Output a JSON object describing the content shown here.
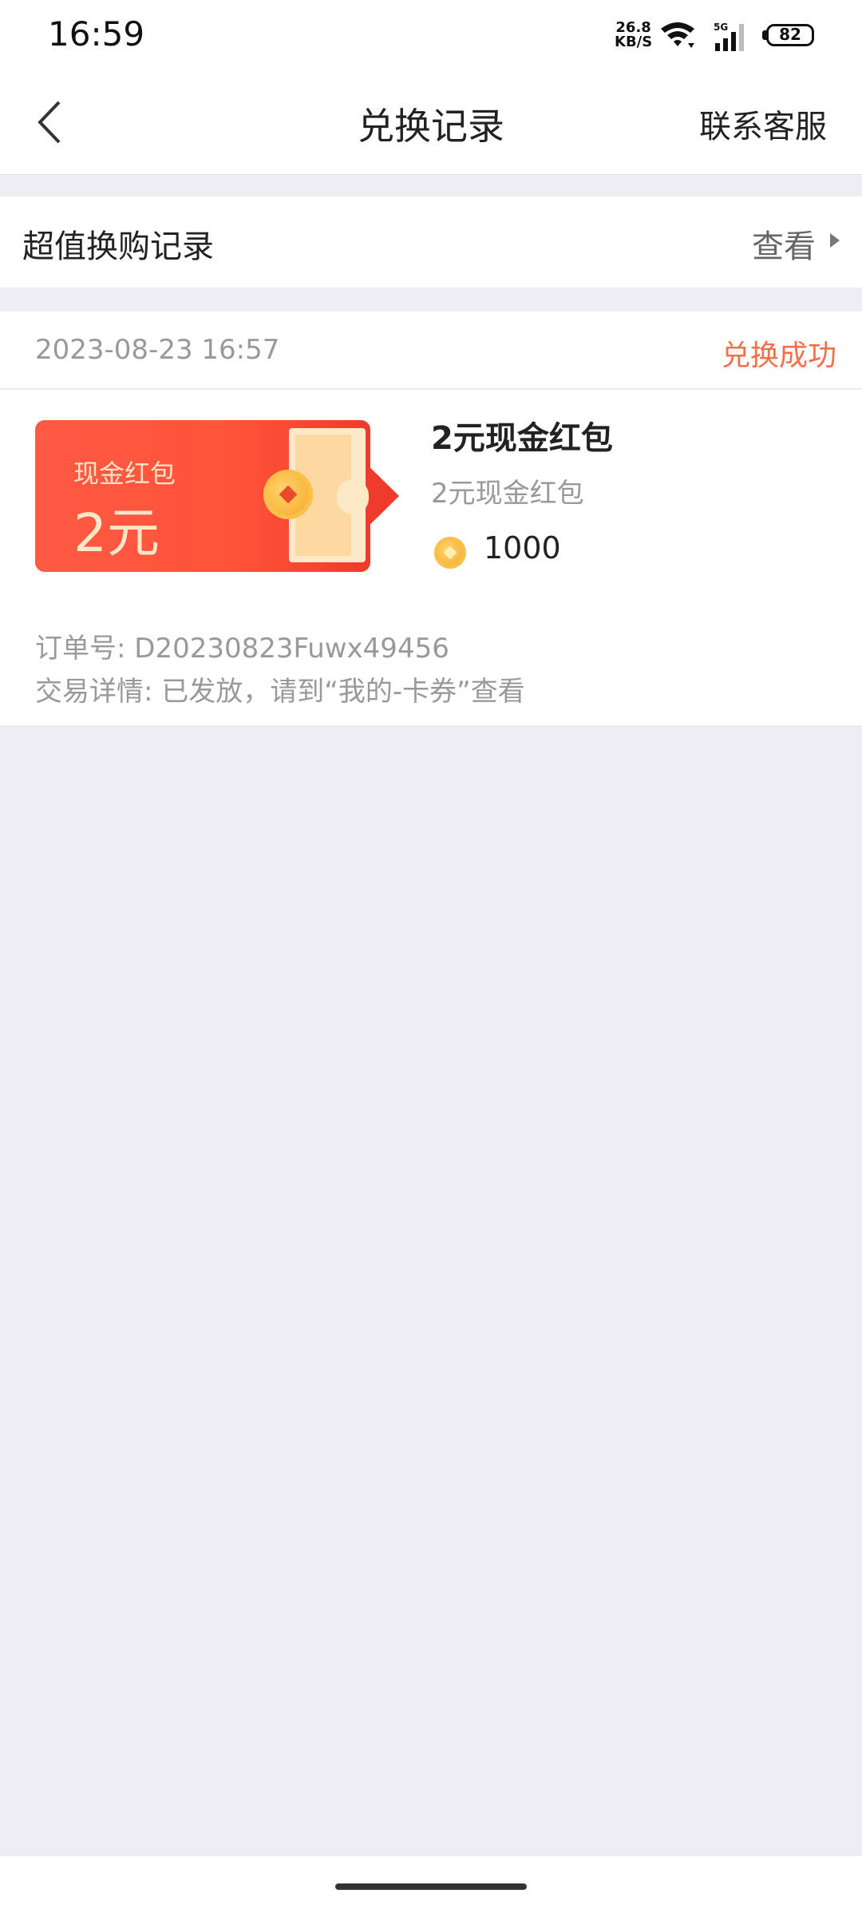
{
  "status_bar": {
    "time": "16:59",
    "net_speed_top": "26.8",
    "net_speed_bottom": "KB/S",
    "signal_label": "5G",
    "battery": "82"
  },
  "header": {
    "title": "兑换记录",
    "contact_label": "联系客服",
    "back_icon": "chevron-left-icon"
  },
  "super_value": {
    "label": "超值换购记录",
    "view_label": "查看",
    "chevron_icon": "chevron-right-icon"
  },
  "order": {
    "date": "2023-08-23 16:57",
    "status": "兑换成功",
    "status_color": "#f2704a",
    "coupon_label": "现金红包",
    "coupon_amount": "2元",
    "product_title": "2元现金红包",
    "product_subtitle": "2元现金红包",
    "coin_icon": "coin-icon",
    "price": "1000",
    "order_number": "订单号: D20230823Fuwx49456",
    "transaction_detail": "交易详情: 已发放，请到“我的-卡券”查看"
  },
  "colors": {
    "background": "#ededf2",
    "coupon_red": "#ff5338",
    "accent_orange": "#f2704a"
  }
}
